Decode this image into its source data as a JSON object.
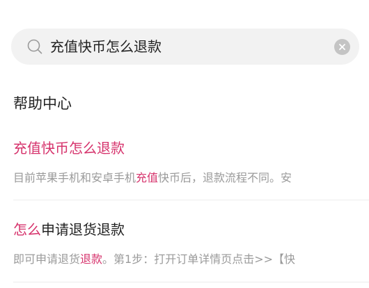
{
  "search": {
    "query": "充值快币怎么退款"
  },
  "section": {
    "title": "帮助中心"
  },
  "results": [
    {
      "title": [
        "充值快币怎么退款"
      ],
      "snippet": [
        "目前苹果手机和安卓手机",
        "充值",
        "快币后，退款流程不同。安"
      ]
    },
    {
      "title": [
        "怎么",
        "申请退货退款"
      ],
      "snippet": [
        "即可申请退货",
        "退款",
        "。第1步：打开订单详情页点击>>【快"
      ]
    }
  ],
  "colors": {
    "highlight": "#d6336c",
    "snippet_text": "#9a9a9a",
    "search_bg": "#f2f2f2"
  }
}
